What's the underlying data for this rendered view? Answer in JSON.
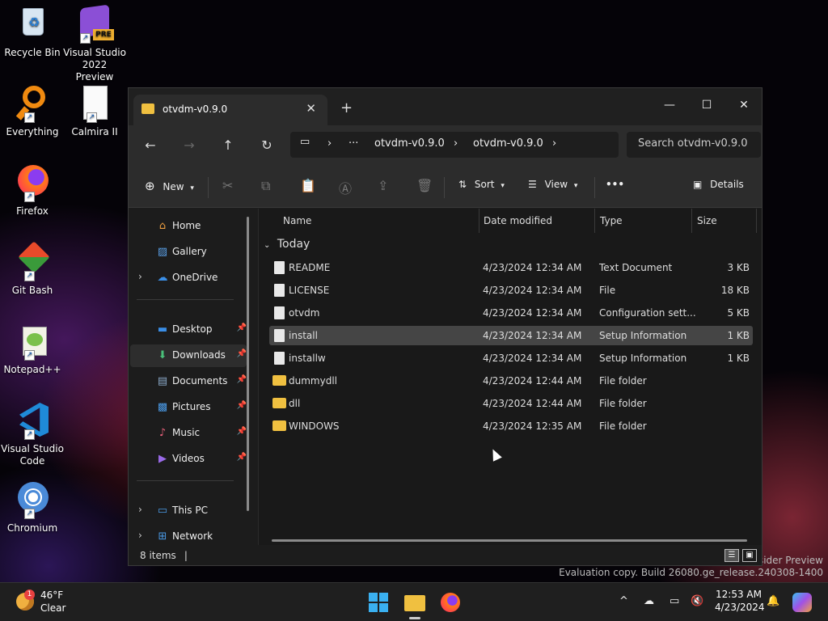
{
  "desktop": {
    "icons": [
      {
        "label": "Recycle Bin"
      },
      {
        "label": "Visual Studio 2022 Preview",
        "badge": "PRE"
      },
      {
        "label": "Everything"
      },
      {
        "label": "Calmira II"
      },
      {
        "label": "Firefox"
      },
      {
        "label": "Git Bash"
      },
      {
        "label": "Notepad++"
      },
      {
        "label": "Visual Studio Code"
      },
      {
        "label": "Chromium"
      }
    ],
    "watermark_line1": "Insider Preview",
    "watermark_line2": "Evaluation copy. Build 26080.ge_release.240308-1400"
  },
  "window": {
    "tab_title": "otvdm-v0.9.0",
    "tab_close": "✕",
    "new_tab": "+",
    "minimize": "—",
    "maximize": "☐",
    "close": "✕",
    "nav": {
      "back": "←",
      "forward": "→",
      "up": "↑",
      "refresh": "↻"
    },
    "breadcrumb": [
      "otvdm-v0.9.0",
      "otvdm-v0.9.0"
    ],
    "breadcrumb_more": "···",
    "search_placeholder": "Search otvdm-v0.9.0",
    "toolbar": {
      "new_label": "New",
      "sort_label": "Sort",
      "view_label": "View",
      "more_label": "•••",
      "details_label": "Details"
    },
    "sidebar": {
      "home": "Home",
      "gallery": "Gallery",
      "onedrive": "OneDrive",
      "desktop": "Desktop",
      "downloads": "Downloads",
      "documents": "Documents",
      "pictures": "Pictures",
      "music": "Music",
      "videos": "Videos",
      "thispc": "This PC",
      "network": "Network"
    },
    "columns": [
      "Name",
      "Date modified",
      "Type",
      "Size"
    ],
    "group_label": "Today",
    "files": [
      {
        "name": "README",
        "date": "4/23/2024 12:34 AM",
        "type": "Text Document",
        "size": "3 KB",
        "kind": "file"
      },
      {
        "name": "LICENSE",
        "date": "4/23/2024 12:34 AM",
        "type": "File",
        "size": "18 KB",
        "kind": "file"
      },
      {
        "name": "otvdm",
        "date": "4/23/2024 12:34 AM",
        "type": "Configuration sett...",
        "size": "5 KB",
        "kind": "file"
      },
      {
        "name": "install",
        "date": "4/23/2024 12:34 AM",
        "type": "Setup Information",
        "size": "1 KB",
        "kind": "file"
      },
      {
        "name": "installw",
        "date": "4/23/2024 12:34 AM",
        "type": "Setup Information",
        "size": "1 KB",
        "kind": "file"
      },
      {
        "name": "dummydll",
        "date": "4/23/2024 12:44 AM",
        "type": "File folder",
        "size": "",
        "kind": "folder"
      },
      {
        "name": "dll",
        "date": "4/23/2024 12:44 AM",
        "type": "File folder",
        "size": "",
        "kind": "folder"
      },
      {
        "name": "WINDOWS",
        "date": "4/23/2024 12:35 AM",
        "type": "File folder",
        "size": "",
        "kind": "folder"
      }
    ],
    "status_count": "8 items"
  },
  "taskbar": {
    "weather_temp": "46°F",
    "weather_desc": "Clear",
    "weather_badge": "1",
    "time": "12:53 AM",
    "date": "4/23/2024",
    "tray_chevron": "^"
  }
}
